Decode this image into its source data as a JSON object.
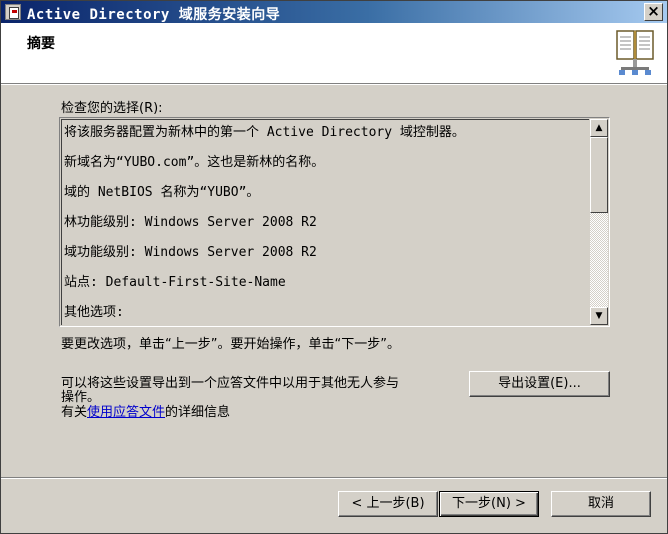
{
  "window": {
    "title": "Active Directory 域服务安装向导",
    "close_glyph": "×"
  },
  "header": {
    "title": "摘要",
    "icon": "book-icon"
  },
  "review": {
    "label": "检查您的选择(R):",
    "lines": [
      "将该服务器配置为新林中的第一个 Active Directory 域控制器。",
      "新域名为“YUBO.com”。这也是新林的名称。",
      "域的 NetBIOS 名称为“YUBO”。",
      "林功能级别: Windows Server 2008 R2",
      "域功能级别: Windows Server 2008 R2",
      "站点: Default-First-Site-Name",
      "其他选项:"
    ]
  },
  "instructions": {
    "change_text": "要更改选项，单击“上一步”。要开始操作，单击“下一步”。",
    "export_text_line1": "可以将这些设置导出到一个应答文件中以用于其他无人参与",
    "export_text_line2": "操作。",
    "more_info_prefix": "有关",
    "more_info_link": "使用应答文件",
    "more_info_suffix": "的详细信息"
  },
  "buttons": {
    "export": "导出设置(E)...",
    "back": "< 上一步(B)",
    "next": "下一步(N) >",
    "cancel": "取消"
  },
  "scrollbar": {
    "up_glyph": "▲",
    "down_glyph": "▼"
  }
}
